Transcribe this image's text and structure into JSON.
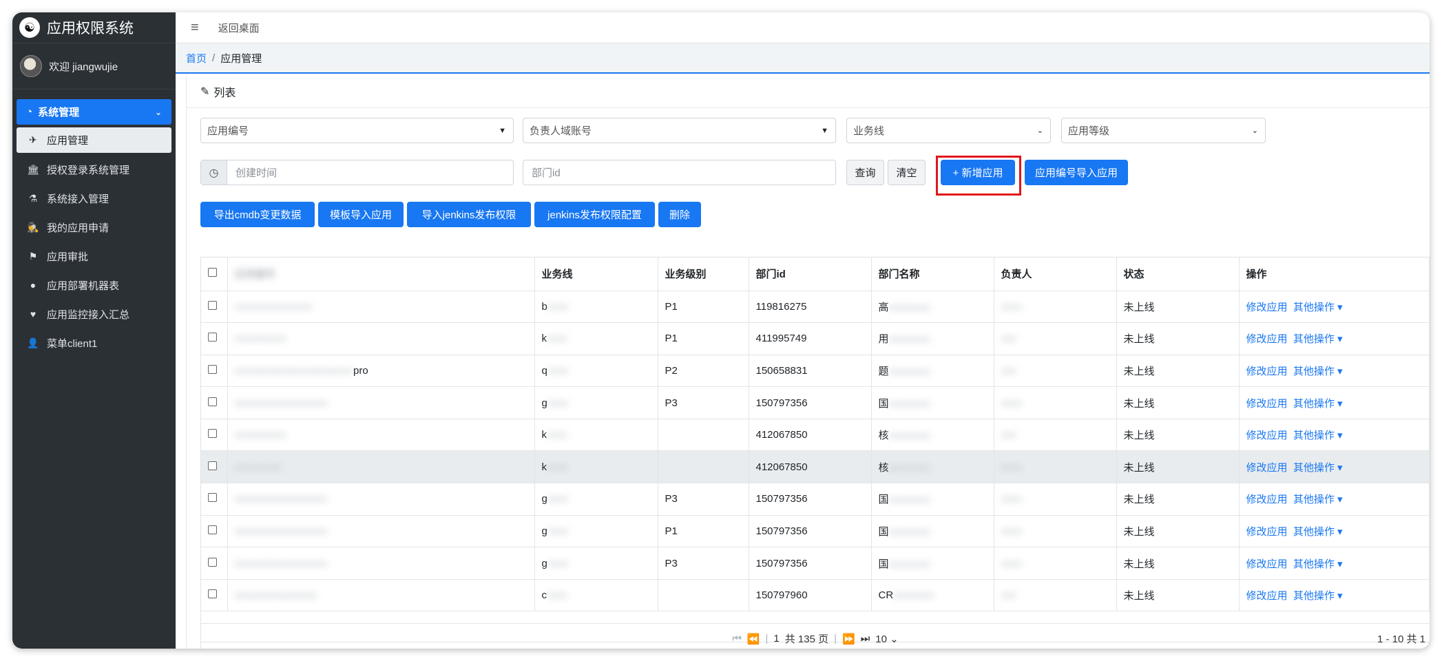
{
  "app": {
    "title": "应用权限系统",
    "welcome": "欢迎 jiangwujie"
  },
  "sidebar": {
    "group": "系统管理",
    "items": [
      {
        "label": "应用管理",
        "icon": "plane-icon"
      },
      {
        "label": "授权登录系统管理",
        "icon": "bank-icon"
      },
      {
        "label": "系统接入管理",
        "icon": "flask-icon"
      },
      {
        "label": "我的应用申请",
        "icon": "user-secret-icon"
      },
      {
        "label": "应用审批",
        "icon": "flag-icon"
      },
      {
        "label": "应用部署机器表",
        "icon": "circle-icon"
      },
      {
        "label": "应用监控接入汇总",
        "icon": "heartbeat-icon"
      },
      {
        "label": "菜单client1",
        "icon": "user-icon"
      }
    ]
  },
  "topbar": {
    "back": "返回桌面"
  },
  "breadcrumb": {
    "home": "首页",
    "sep": "/",
    "current": "应用管理"
  },
  "panel": {
    "title": "列表"
  },
  "filters": {
    "app_code": "应用编号",
    "owner_account": "负责人域账号",
    "business_line": "业务线",
    "app_level": "应用等级",
    "create_time_ph": "创建时间",
    "dept_id_ph": "部门id"
  },
  "buttons": {
    "query": "查询",
    "clear": "清空",
    "add_app": "+ 新增应用",
    "import_by_code": "应用编号导入应用",
    "export_cmdb": "导出cmdb变更数据",
    "template_import": "模板导入应用",
    "import_jenkins": "导入jenkins发布权限",
    "jenkins_config": "jenkins发布权限配置",
    "delete": "删除"
  },
  "table": {
    "headers": [
      "",
      "业务线",
      "业务级别",
      "部门id",
      "部门名称",
      "负责人",
      "状态",
      "操作"
    ],
    "first_header_blur": "应用编号",
    "rows": [
      {
        "app": "xxxxxxxxxxxxxxx",
        "line": "b",
        "level": "P1",
        "dept": "119816275",
        "dname": "高",
        "owner": "xxxx",
        "status": "未上线",
        "selected": false
      },
      {
        "app": "xxxxxxxxxx",
        "line": "k",
        "level": "P1",
        "dept": "411995749",
        "dname": "用",
        "owner": "xxx",
        "status": "未上线",
        "selected": false
      },
      {
        "app": "xxxxxxxxxxxxxxxxxxxxxxx",
        "app_suffix": "pro",
        "line": "q",
        "level": "P2",
        "dept": "150658831",
        "dname": "题",
        "owner": "xxx",
        "status": "未上线",
        "selected": false
      },
      {
        "app": "xxxxxxxxxxxxxxxxxx",
        "line": "g",
        "level": "P3",
        "dept": "150797356",
        "dname": "国",
        "owner": "xxxx",
        "status": "未上线",
        "selected": false
      },
      {
        "app": "xxxxxxxxxx",
        "line": "k",
        "level": "",
        "dept": "412067850",
        "dname": "核",
        "owner": "xxx",
        "status": "未上线",
        "selected": false
      },
      {
        "app": "xxxxxxxxx",
        "line": "k",
        "level": "",
        "dept": "412067850",
        "dname": "核",
        "owner": "xxxx",
        "status": "未上线",
        "selected": true
      },
      {
        "app": "xxxxxxxxxxxxxxxxxx",
        "line": "g",
        "level": "P3",
        "dept": "150797356",
        "dname": "国",
        "owner": "xxxx",
        "status": "未上线",
        "selected": false
      },
      {
        "app": "xxxxxxxxxxxxxxxxxx",
        "line": "g",
        "level": "P1",
        "dept": "150797356",
        "dname": "国",
        "owner": "xxxx",
        "status": "未上线",
        "selected": false
      },
      {
        "app": "xxxxxxxxxxxxxxxxxx",
        "line": "g",
        "level": "P3",
        "dept": "150797356",
        "dname": "国",
        "owner": "xxxx",
        "status": "未上线",
        "selected": false
      },
      {
        "app": "xxxxxxxxxxxxxxxx",
        "line": "c",
        "level": "",
        "dept": "150797960",
        "dname": "CR",
        "owner": "xxx",
        "status": "未上线",
        "selected": false
      }
    ],
    "action_edit": "修改应用",
    "action_more": "其他操作"
  },
  "pagination": {
    "page": "1",
    "total": "共 135 页",
    "page_size": "10",
    "range": "1 - 10  共 1"
  },
  "colors": {
    "primary": "#1877f2",
    "sidebar_bg": "#2b3035",
    "highlight": "#e0161b"
  }
}
